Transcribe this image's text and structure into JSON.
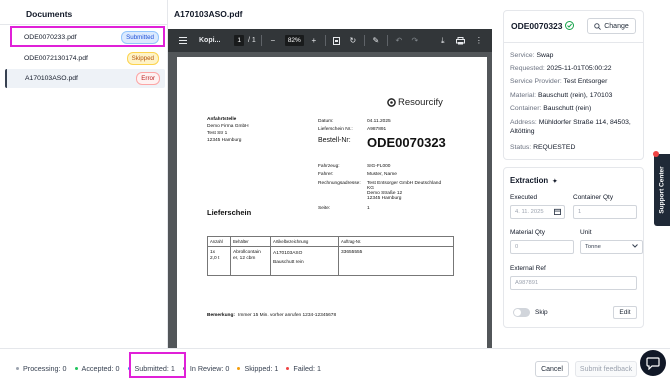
{
  "documents": {
    "title": "Documents",
    "items": [
      {
        "name": "ODE0070233.pdf",
        "status": "Submitted"
      },
      {
        "name": "ODE0072130174.pdf",
        "status": "Skipped"
      },
      {
        "name": "A170103ASO.pdf",
        "status": "Error"
      }
    ]
  },
  "viewer": {
    "title": "A170103ASO.pdf",
    "toolbar": {
      "filename": "Kopi...",
      "page": "1",
      "page_total": "/ 1",
      "zoom": "82%"
    }
  },
  "pdf": {
    "logo": "Resourcify",
    "sender_label": "Anfahrtstelle",
    "sender_lines": [
      "Demo Firma GmbH",
      "Test Str 1",
      "12345 Hamburg"
    ],
    "datum_label": "Datum:",
    "datum_value": "04.11.2025",
    "liefer_label": "Lieferschein Nr.:",
    "liefer_value": "A987891",
    "bestell_label": "Bestell-Nr:",
    "bestell_value": "ODE0070323",
    "fahrzeug_label": "Fahrzeug:",
    "fahrzeug_value": "SIG-FL000",
    "fahrer_label": "Fahrer:",
    "fahrer_value": "Muster, Name",
    "rechnung_label": "Rechnungsadresse:",
    "rechnung_lines": [
      "Test Entsorger GmbH Deutschland",
      "KG",
      "Demo Straße 12",
      "12345 Hamburg"
    ],
    "seite_label": "Seite:",
    "seite_value": "1",
    "doc_type": "Lieferschein",
    "table_headers": [
      "Anzahl",
      "Behälter",
      "Artikelbezeichnung",
      "Auftrag-Nr."
    ],
    "table_row": {
      "anzahl": "1x\n2,0 t",
      "behaelter": "Abrollcontain\ner, 12 cbm",
      "artikel": "A170103ASO\nBauschutt rein",
      "auftrag": "33655555"
    },
    "remark_label": "Bemerkung:",
    "remark_text": "Immer 15 Min. vorher anrufen 1234-12345678"
  },
  "detail": {
    "order_id": "ODE0070323",
    "change_label": "Change",
    "fields": [
      {
        "key": "Service:",
        "value": "Swap"
      },
      {
        "key": "Requested:",
        "value": "2025-11-01T05:00:22"
      },
      {
        "key": "Service Provider:",
        "value": "Test Entsorger"
      },
      {
        "key": "Material:",
        "value": "Bauschutt (rein), 170103"
      },
      {
        "key": "Container:",
        "value": "Bauschutt (rein)"
      },
      {
        "key": "Address:",
        "value": "Mühldorfer Straße 114, 84503, Altötting"
      },
      {
        "key": "Status:",
        "value": "REQUESTED"
      }
    ]
  },
  "extraction": {
    "title": "Extraction",
    "executed_label": "Executed",
    "executed_value": "4. 11. 2025",
    "container_qty_label": "Container Qty",
    "container_qty_value": "1",
    "material_qty_label": "Material Qty",
    "material_qty_placeholder": "0",
    "unit_label": "Unit",
    "unit_value": "Tonne",
    "external_ref_label": "External Ref",
    "external_ref_value": "A987891",
    "skip_label": "Skip",
    "edit_label": "Edit"
  },
  "support_label": "Support Center",
  "status_bar": {
    "processing": "Processing: 0",
    "accepted": "Accepted: 0",
    "submitted": "Submitted: 1",
    "in_review": "In Review: 0",
    "skipped": "Skipped: 1",
    "failed": "Failed: 1"
  },
  "actions": {
    "cancel": "Cancel",
    "submit": "Submit feedback"
  },
  "colors": {
    "highlight": "#e020d8",
    "toolbar": "#323639",
    "pdf_background": "#525659",
    "success": "#16a34a"
  }
}
